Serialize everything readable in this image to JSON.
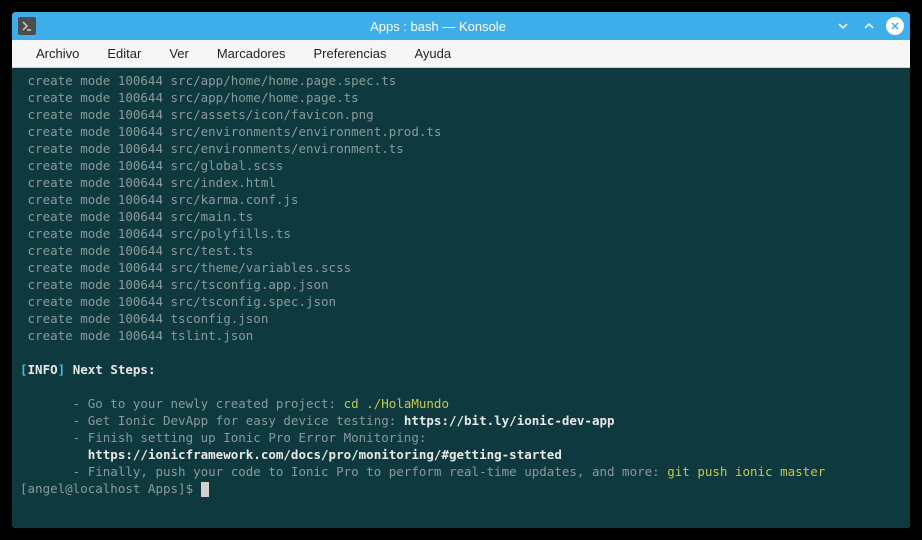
{
  "window": {
    "title": "Apps : bash — Konsole"
  },
  "menubar": {
    "items": [
      "Archivo",
      "Editar",
      "Ver",
      "Marcadores",
      "Preferencias",
      "Ayuda"
    ]
  },
  "terminal": {
    "create_lines": [
      " create mode 100644 src/app/home/home.page.spec.ts",
      " create mode 100644 src/app/home/home.page.ts",
      " create mode 100644 src/assets/icon/favicon.png",
      " create mode 100644 src/environments/environment.prod.ts",
      " create mode 100644 src/environments/environment.ts",
      " create mode 100644 src/global.scss",
      " create mode 100644 src/index.html",
      " create mode 100644 src/karma.conf.js",
      " create mode 100644 src/main.ts",
      " create mode 100644 src/polyfills.ts",
      " create mode 100644 src/test.ts",
      " create mode 100644 src/theme/variables.scss",
      " create mode 100644 src/tsconfig.app.json",
      " create mode 100644 src/tsconfig.spec.json",
      " create mode 100644 tsconfig.json",
      " create mode 100644 tslint.json"
    ],
    "info_bracket_open": "[",
    "info_label": "INFO",
    "info_bracket_close": "]",
    "next_steps_label": " Next Steps:",
    "step1_prefix": "       - Go to your newly created project: ",
    "step1_cmd": "cd ./HolaMundo",
    "step2_prefix": "       - Get Ionic DevApp for easy device testing: ",
    "step2_link": "https://bit.ly/ionic-dev-app",
    "step3_line": "       - Finish setting up Ionic Pro Error Monitoring: ",
    "step3_link": "https://ionicframework.com/docs/pro/monitoring/#getting-started",
    "step3_link_pad": "         ",
    "step4_prefix": "       - Finally, push your code to Ionic Pro to perform real-time updates, and more: ",
    "step4_cmd": "git push ionic master",
    "prompt": "[angel@localhost Apps]$ "
  }
}
